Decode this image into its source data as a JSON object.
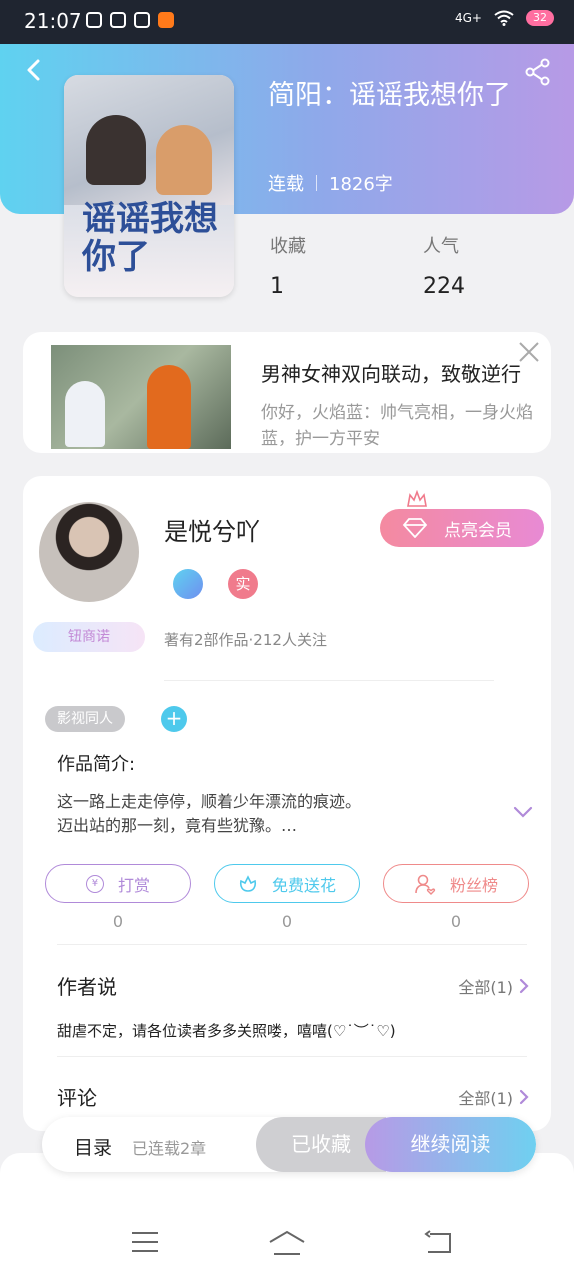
{
  "status_bar": {
    "time": "21:07",
    "network": "4G+",
    "battery": "32"
  },
  "book": {
    "title": "简阳：谣谣我想你了",
    "status": "连载",
    "word_count": "1826字",
    "cover_title": "谣谣我想你了",
    "stats": [
      {
        "label": "收藏",
        "value": "1"
      },
      {
        "label": "人气",
        "value": "224"
      }
    ]
  },
  "ad": {
    "title": "男神女神双向联动，致敬逆行",
    "description": "你好，火焰蓝：帅气亮相，一身火焰蓝，护一方平安"
  },
  "author": {
    "name": "是悦兮吖",
    "vip_button": "点亮会员",
    "real_badge": "实",
    "fan_badge": "钮商诺",
    "stats": "著有2部作品·212人关注"
  },
  "work": {
    "tag": "影视同人",
    "add_tag": "+",
    "intro_label": "作品简介:",
    "intro_text": "这一路上走走停停，顺着少年漂流的痕迹。\n迈出站的那一刻，竟有些犹豫。…"
  },
  "actions": [
    {
      "label": "打赏",
      "count": "0",
      "color": "#b08ad9",
      "icon": "yen-icon"
    },
    {
      "label": "免费送花",
      "count": "0",
      "color": "#4ec9ec",
      "icon": "flower-icon"
    },
    {
      "label": "粉丝榜",
      "count": "0",
      "color": "#ef8a8a",
      "icon": "fan-icon"
    }
  ],
  "author_say": {
    "title": "作者说",
    "more": "全部(1)",
    "text": "甜虐不定，请各位读者多多关照喽，嘻嘻(♡˙︶˙♡)"
  },
  "comments": {
    "title": "评论",
    "more": "全部(1)"
  },
  "bottom": {
    "toc": "目录",
    "chapter_status": "已连载2章",
    "collected": "已收藏",
    "continue_read": "继续阅读"
  },
  "colors": {
    "header_start": "#5fd2f0",
    "header_end": "#b79ae6",
    "vip": "#f48aa0"
  }
}
